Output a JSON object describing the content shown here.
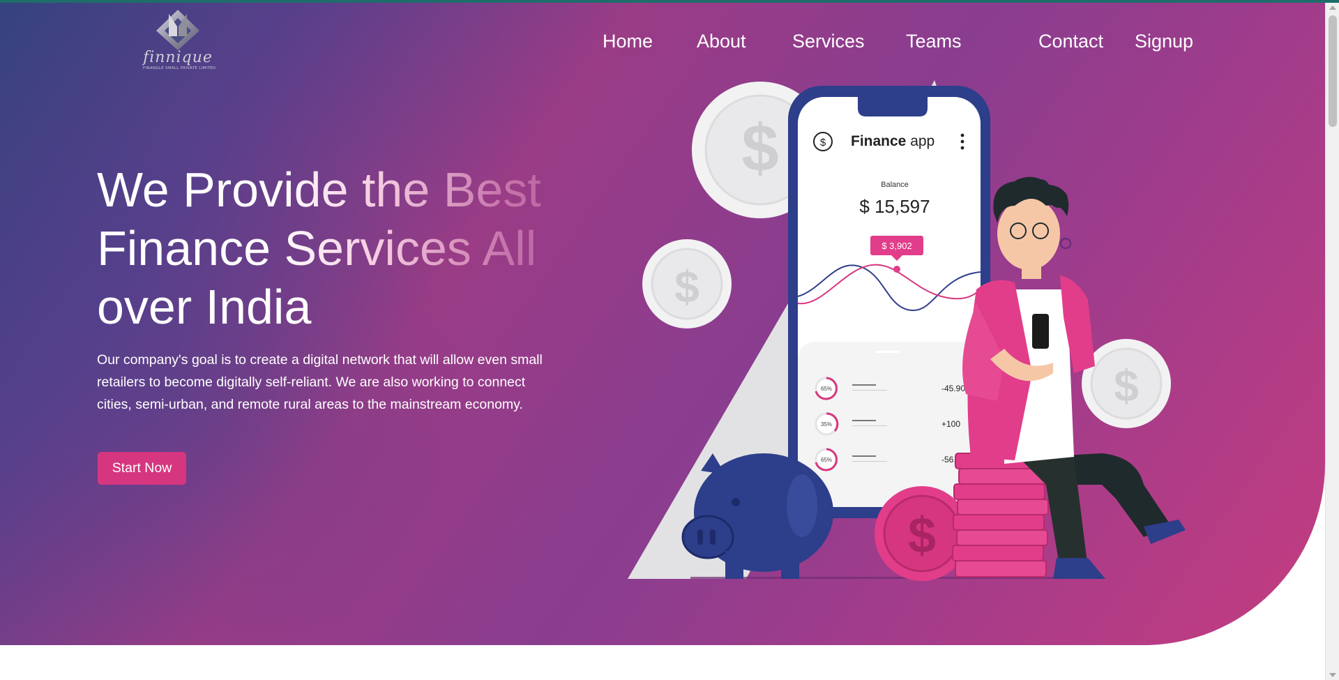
{
  "brand": {
    "name": "finnique",
    "tagline": "FINANGLE SMALL PRIVATE LIMITED"
  },
  "nav": {
    "items": [
      "Home",
      "About",
      "Services",
      "Teams",
      "Contact",
      "Signup"
    ]
  },
  "hero": {
    "headline_lines": [
      "We Provide the Best",
      "Finance Services All",
      "over India"
    ],
    "description": "Our company's goal is to create a digital network that will allow even small retailers to become digitally self-reliant. We are also working to connect cities, semi-urban, and remote rural areas to the mainstream economy.",
    "cta_label": "Start Now"
  },
  "phone_app": {
    "title_bold": "Finance",
    "title_rest": " app",
    "balance_label": "Balance",
    "balance_value": "$ 15,597",
    "tooltip_value": "$ 3,902",
    "rows": [
      {
        "percent": "65%",
        "amount": "-45.90"
      },
      {
        "percent": "35%",
        "amount": "+100"
      },
      {
        "percent": "65%",
        "amount": "-56.90"
      }
    ]
  },
  "colors": {
    "accent_pink": "#d6367f",
    "navy": "#2d3e8a",
    "gradient_start": "#35427f",
    "gradient_end": "#c43c80"
  },
  "icons": {
    "dollar_coin": "dollar-coin-icon",
    "menu": "more-vertical-icon",
    "app_logo": "dollar-circle-icon"
  }
}
